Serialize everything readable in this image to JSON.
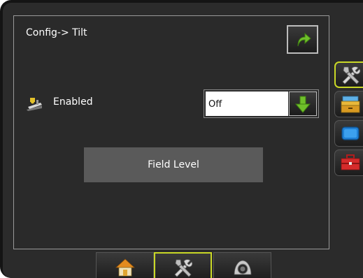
{
  "header": {
    "title": "Config-> Tilt"
  },
  "tilt": {
    "enabled_label": "Enabled",
    "enabled_value": "Off"
  },
  "field_level_label": "Field Level",
  "colors": {
    "accent": "#c9d826",
    "arrow_green": "#6fbf2a",
    "panel_border": "#9a9a9a",
    "button_gray": "#5a5a5a"
  },
  "side_tabs": [
    {
      "icon": "tools-icon",
      "active": true
    },
    {
      "icon": "console-icon",
      "active": false
    },
    {
      "icon": "monitor-icon",
      "active": false
    },
    {
      "icon": "toolbox-icon",
      "active": false
    }
  ],
  "bottom_tabs": [
    {
      "icon": "home-icon",
      "active": false
    },
    {
      "icon": "tools-icon",
      "active": true
    },
    {
      "icon": "camera-icon",
      "active": false
    }
  ]
}
